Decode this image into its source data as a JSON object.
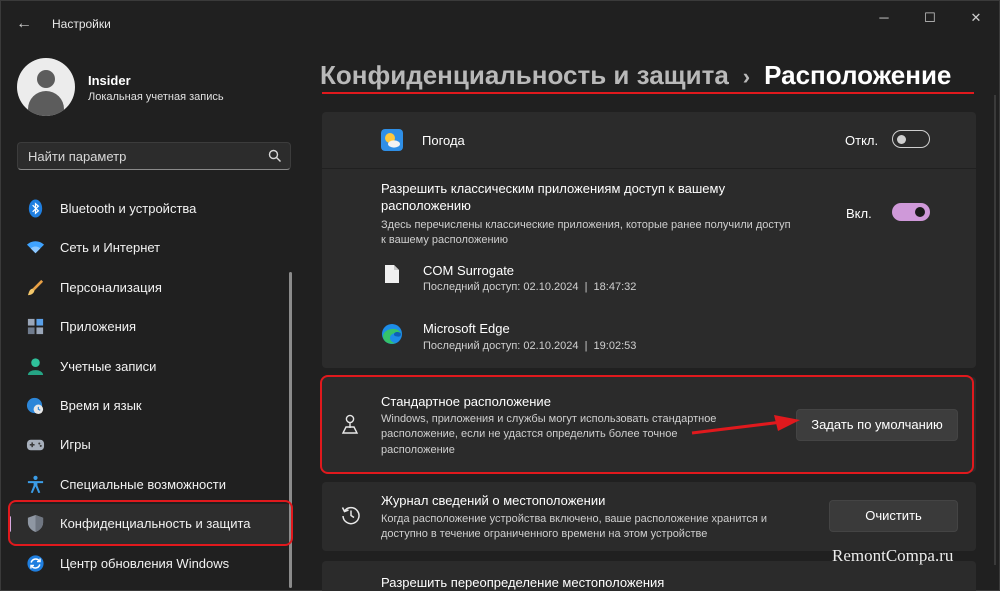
{
  "window": {
    "title": "Настройки",
    "minimize": "─",
    "maximize": "☐",
    "close": "✕",
    "back": "←"
  },
  "user": {
    "name": "Insider",
    "account_type": "Локальная учетная запись"
  },
  "search": {
    "placeholder": "Найти параметр"
  },
  "sidebar": {
    "items": [
      {
        "label": "Bluetooth и устройства",
        "icon": "bluetooth-icon"
      },
      {
        "label": "Сеть и Интернет",
        "icon": "wifi-icon"
      },
      {
        "label": "Персонализация",
        "icon": "brush-icon"
      },
      {
        "label": "Приложения",
        "icon": "apps-icon"
      },
      {
        "label": "Учетные записи",
        "icon": "account-icon"
      },
      {
        "label": "Время и язык",
        "icon": "globe-clock-icon"
      },
      {
        "label": "Игры",
        "icon": "gamepad-icon"
      },
      {
        "label": "Специальные возможности",
        "icon": "accessibility-icon"
      },
      {
        "label": "Конфиденциальность и защита",
        "icon": "shield-icon",
        "active": true
      },
      {
        "label": "Центр обновления Windows",
        "icon": "update-icon"
      }
    ]
  },
  "breadcrumb": {
    "parent": "Конфиденциальность и защита",
    "separator": "›",
    "current": "Расположение"
  },
  "weather": {
    "label": "Погода",
    "toggle_state": "Откл.",
    "on": false
  },
  "classic": {
    "title_line1": "Разрешить классическим приложениям доступ к вашему",
    "title_line2": "расположению",
    "desc_line1": "Здесь перечислены классические приложения, которые ранее получили доступ",
    "desc_line2": "к вашему расположению",
    "toggle_state": "Вкл.",
    "on": true,
    "apps": [
      {
        "name": "COM Surrogate",
        "last_access": "Последний доступ: 02.10.2024  |  18:47:32"
      },
      {
        "name": "Microsoft Edge",
        "last_access": "Последний доступ: 02.10.2024  |  19:02:53"
      }
    ]
  },
  "default_location": {
    "title": "Стандартное расположение",
    "desc_line1": "Windows, приложения и службы могут использовать стандартное",
    "desc_line2": "расположение, если не удастся определить более точное",
    "desc_line3": "расположение",
    "button": "Задать по умолчанию"
  },
  "history": {
    "title": "Журнал сведений о местоположении",
    "desc_line1": "Когда расположение устройства включено, ваше расположение хранится и",
    "desc_line2": "доступно в течение ограниченного времени на этом устройстве",
    "button": "Очистить"
  },
  "override": {
    "title": "Разрешить переопределение местоположения"
  },
  "watermark": "RemontCompa.ru",
  "colors": {
    "accent": "#cf99d9",
    "highlight": "#e0191d",
    "background": "#202020",
    "card": "#2b2b2b"
  }
}
